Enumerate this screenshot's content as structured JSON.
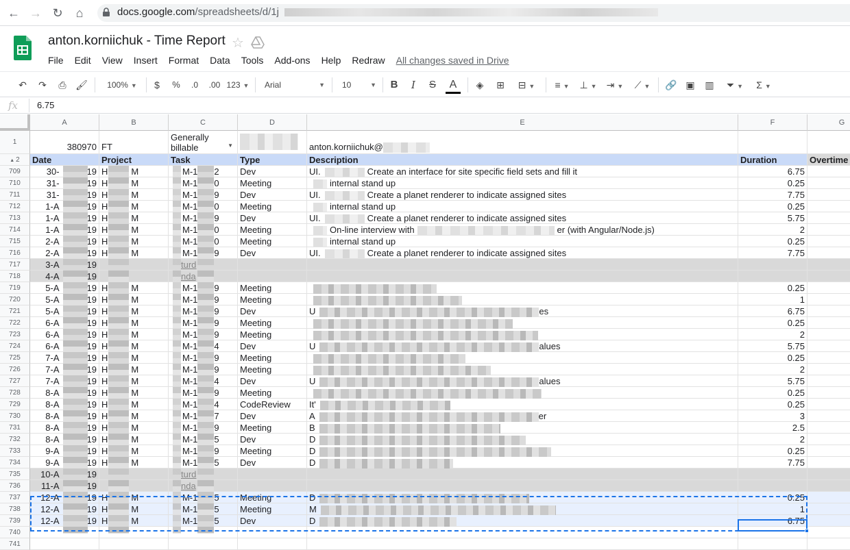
{
  "browser": {
    "url_host": "docs.google.com",
    "url_path": "/spreadsheets/d/1j"
  },
  "doc": {
    "title": "anton.korniichuk - Time Report",
    "menu": [
      "File",
      "Edit",
      "View",
      "Insert",
      "Format",
      "Data",
      "Tools",
      "Add-ons",
      "Help",
      "Redraw"
    ],
    "saved_status": "All changes saved in Drive"
  },
  "toolbar": {
    "zoom": "100%",
    "currency": "$",
    "percent": "%",
    "dec_less": ".0",
    "dec_more": ".00",
    "more_formats": "123",
    "font": "Arial",
    "font_size": "10",
    "bold": "B",
    "italic": "I",
    "strike": "S",
    "text_color": "A",
    "sum": "Σ"
  },
  "formula_bar": {
    "label": "fx",
    "value": "6.75"
  },
  "columns": [
    "A",
    "B",
    "C",
    "D",
    "E",
    "F",
    "G"
  ],
  "row1": {
    "num": "1",
    "a": "380970",
    "b": "FT",
    "c": "Generally billable",
    "e": "anton.korniichuk@"
  },
  "header_row": {
    "num": "2",
    "date": "Date",
    "project": "Project",
    "task": "Task",
    "type": "Type",
    "description": "Description",
    "duration": "Duration",
    "overtime": "Overtime"
  },
  "rows": [
    {
      "num": "709",
      "date": "30-",
      "y": "19",
      "proj_a": "H",
      "proj_b": "M",
      "task_a": "M-1",
      "task_b": "2",
      "type": "Dev",
      "desc_prefix": "UI.",
      "desc": "Create an interface for site specific field sets and fill it",
      "dur": "6.75"
    },
    {
      "num": "710",
      "date": "31-",
      "y": "19",
      "proj_a": "H",
      "proj_b": "M",
      "task_a": "M-1",
      "task_b": "0",
      "type": "Meeting",
      "desc_prefix": "",
      "desc": "internal stand up",
      "dur": "0.25"
    },
    {
      "num": "711",
      "date": "31-",
      "y": "19",
      "proj_a": "H",
      "proj_b": "M",
      "task_a": "M-1",
      "task_b": "9",
      "type": "Dev",
      "desc_prefix": "UI.",
      "desc": "Create a planet renderer to indicate assigned sites",
      "dur": "7.75"
    },
    {
      "num": "712",
      "date": "1-A",
      "y": "19",
      "proj_a": "H",
      "proj_b": "M",
      "task_a": "M-1",
      "task_b": "0",
      "type": "Meeting",
      "desc_prefix": "",
      "desc": "internal stand up",
      "dur": "0.25"
    },
    {
      "num": "713",
      "date": "1-A",
      "y": "19",
      "proj_a": "H",
      "proj_b": "M",
      "task_a": "M-1",
      "task_b": "9",
      "type": "Dev",
      "desc_prefix": "UI.",
      "desc": "Create a planet renderer to indicate assigned sites",
      "dur": "5.75"
    },
    {
      "num": "714",
      "date": "1-A",
      "y": "19",
      "proj_a": "H",
      "proj_b": "M",
      "task_a": "M-1",
      "task_b": "0",
      "type": "Meeting",
      "desc_prefix": "",
      "desc": "On-line interview with",
      "desc_suffix": "er (with Angular/Node.js)",
      "dur": "2"
    },
    {
      "num": "715",
      "date": "2-A",
      "y": "19",
      "proj_a": "H",
      "proj_b": "M",
      "task_a": "M-1",
      "task_b": "0",
      "type": "Meeting",
      "desc_prefix": "",
      "desc": "internal stand up",
      "dur": "0.25"
    },
    {
      "num": "716",
      "date": "2-A",
      "y": "19",
      "proj_a": "H",
      "proj_b": "M",
      "task_a": "M-1",
      "task_b": "9",
      "type": "Dev",
      "desc_prefix": "UI.",
      "desc": "Create a planet renderer to indicate assigned sites",
      "dur": "7.75"
    },
    {
      "num": "717",
      "date": "3-A",
      "y": "19",
      "weekend": "turd",
      "is_weekend": true
    },
    {
      "num": "718",
      "date": "4-A",
      "y": "19",
      "weekend": "nda",
      "is_weekend": true
    },
    {
      "num": "719",
      "date": "5-A",
      "y": "19",
      "proj_a": "H",
      "proj_b": "M",
      "task_a": "M-1",
      "task_b": "9",
      "type": "Meeting",
      "desc_prefix": "",
      "desc": "",
      "dur": "0.25"
    },
    {
      "num": "720",
      "date": "5-A",
      "y": "19",
      "proj_a": "H",
      "proj_b": "M",
      "task_a": "M-1",
      "task_b": "9",
      "type": "Meeting",
      "desc_prefix": "",
      "desc": "",
      "dur": "1"
    },
    {
      "num": "721",
      "date": "5-A",
      "y": "19",
      "proj_a": "H",
      "proj_b": "M",
      "task_a": "M-1",
      "task_b": "9",
      "type": "Dev",
      "desc_prefix": "U",
      "desc": "",
      "desc_suffix": "es",
      "dur": "6.75"
    },
    {
      "num": "722",
      "date": "6-A",
      "y": "19",
      "proj_a": "H",
      "proj_b": "M",
      "task_a": "M-1",
      "task_b": "9",
      "type": "Meeting",
      "desc_prefix": "",
      "desc": "",
      "dur": "0.25"
    },
    {
      "num": "723",
      "date": "6-A",
      "y": "19",
      "proj_a": "H",
      "proj_b": "M",
      "task_a": "M-1",
      "task_b": "9",
      "type": "Meeting",
      "desc_prefix": "",
      "desc": "",
      "dur": "2"
    },
    {
      "num": "724",
      "date": "6-A",
      "y": "19",
      "proj_a": "H",
      "proj_b": "M",
      "task_a": "M-1",
      "task_b": "4",
      "type": "Dev",
      "desc_prefix": "U",
      "desc": "",
      "desc_suffix": "alues",
      "dur": "5.75"
    },
    {
      "num": "725",
      "date": "7-A",
      "y": "19",
      "proj_a": "H",
      "proj_b": "M",
      "task_a": "M-1",
      "task_b": "9",
      "type": "Meeting",
      "desc_prefix": "",
      "desc": "",
      "dur": "0.25"
    },
    {
      "num": "726",
      "date": "7-A",
      "y": "19",
      "proj_a": "H",
      "proj_b": "M",
      "task_a": "M-1",
      "task_b": "9",
      "type": "Meeting",
      "desc_prefix": "",
      "desc": "",
      "dur": "2"
    },
    {
      "num": "727",
      "date": "7-A",
      "y": "19",
      "proj_a": "H",
      "proj_b": "M",
      "task_a": "M-1",
      "task_b": "4",
      "type": "Dev",
      "desc_prefix": "U",
      "desc": "",
      "desc_suffix": "alues",
      "dur": "5.75"
    },
    {
      "num": "728",
      "date": "8-A",
      "y": "19",
      "proj_a": "H",
      "proj_b": "M",
      "task_a": "M-1",
      "task_b": "9",
      "type": "Meeting",
      "desc_prefix": "",
      "desc": "",
      "dur": "0.25"
    },
    {
      "num": "729",
      "date": "8-A",
      "y": "19",
      "proj_a": "H",
      "proj_b": "M",
      "task_a": "M-1",
      "task_b": "4",
      "type": "CodeReview",
      "desc_prefix": "It'",
      "desc": "",
      "dur": "0.25"
    },
    {
      "num": "730",
      "date": "8-A",
      "y": "19",
      "proj_a": "H",
      "proj_b": "M",
      "task_a": "M-1",
      "task_b": "7",
      "type": "Dev",
      "desc_prefix": "A",
      "desc": "",
      "desc_suffix": "er",
      "dur": "3"
    },
    {
      "num": "731",
      "date": "8-A",
      "y": "19",
      "proj_a": "H",
      "proj_b": "M",
      "task_a": "M-1",
      "task_b": "9",
      "type": "Meeting",
      "desc_prefix": "B",
      "desc": "",
      "dur": "2.5"
    },
    {
      "num": "732",
      "date": "8-A",
      "y": "19",
      "proj_a": "H",
      "proj_b": "M",
      "task_a": "M-1",
      "task_b": "5",
      "type": "Dev",
      "desc_prefix": "D",
      "desc": "",
      "dur": "2"
    },
    {
      "num": "733",
      "date": "9-A",
      "y": "19",
      "proj_a": "H",
      "proj_b": "M",
      "task_a": "M-1",
      "task_b": "9",
      "type": "Meeting",
      "desc_prefix": "D",
      "desc": "",
      "dur": "0.25"
    },
    {
      "num": "734",
      "date": "9-A",
      "y": "19",
      "proj_a": "H",
      "proj_b": "M",
      "task_a": "M-1",
      "task_b": "5",
      "type": "Dev",
      "desc_prefix": "D",
      "desc": "",
      "dur": "7.75"
    },
    {
      "num": "735",
      "date": "10-A",
      "y": "19",
      "weekend": "turd",
      "is_weekend": true
    },
    {
      "num": "736",
      "date": "11-A",
      "y": "19",
      "weekend": "nda",
      "is_weekend": true
    },
    {
      "num": "737",
      "date": "12-A",
      "y": "19",
      "proj_a": "H",
      "proj_b": "M",
      "task_a": "M-1",
      "task_b": "5",
      "type": "Meeting",
      "desc_prefix": "D",
      "desc": "",
      "dur": "0.25",
      "selected": true
    },
    {
      "num": "738",
      "date": "12-A",
      "y": "19",
      "proj_a": "H",
      "proj_b": "M",
      "task_a": "M-1",
      "task_b": "5",
      "type": "Meeting",
      "desc_prefix": "M",
      "desc": "",
      "dur": "1",
      "selected": true
    },
    {
      "num": "739",
      "date": "12-A",
      "y": "19",
      "proj_a": "H",
      "proj_b": "M",
      "task_a": "M-1",
      "task_b": "5",
      "type": "Dev",
      "desc_prefix": "D",
      "desc": "",
      "dur": "6.75",
      "selected": true
    },
    {
      "num": "740"
    },
    {
      "num": "741"
    }
  ],
  "colors": {
    "header_blue": "#c9daf8",
    "weekend_gray": "#d9d9d9",
    "selection_blue": "#1a73e8",
    "sheets_green": "#0f9d58"
  }
}
